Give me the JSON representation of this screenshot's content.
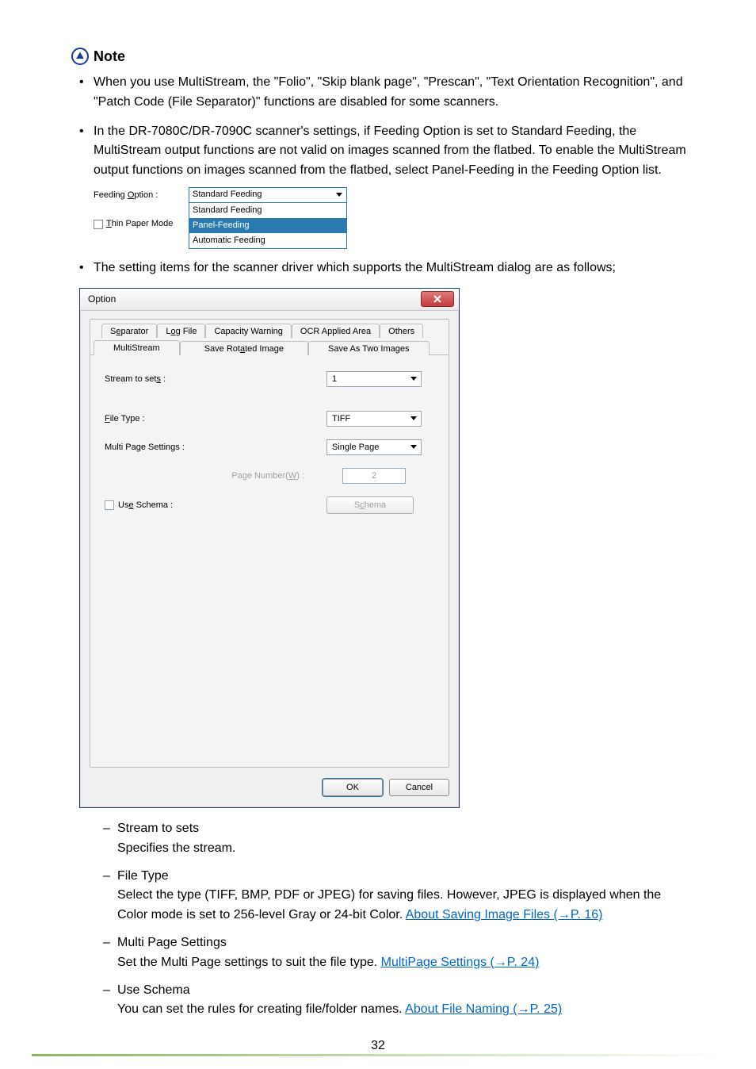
{
  "note": {
    "label": "Note"
  },
  "bullets": {
    "b1": "When you use MultiStream, the \"Folio\", \"Skip blank page\", \"Prescan\", \"Text Orientation Recognition\", and \"Patch Code (File Separator)\" functions are disabled for some scanners.",
    "b2": "In the DR-7080C/DR-7090C scanner's settings, if Feeding Option is set to Standard Feeding, the MultiStream output functions are not valid on images scanned from the flatbed. To enable the MultiStream output functions on images scanned from the flatbed, select Panel-Feeding in the Feeding Option list.",
    "b3": "The setting items for the scanner driver which supports the MultiStream dialog are as follows;"
  },
  "feed": {
    "label_option": "Feeding Option :",
    "label_thin": "Thin Paper Mode",
    "sel": "Standard Feeding",
    "opt1": "Standard Feeding",
    "opt2": "Panel-Feeding",
    "opt3": "Automatic Feeding"
  },
  "dialog": {
    "title": "Option",
    "tabs_row1": {
      "separator_pre": "S",
      "separator_u": "e",
      "separator_post": "parator",
      "logfile_pre": "L",
      "logfile_u": "o",
      "logfile_post": "g File",
      "capacity": "Capacity Warning",
      "ocr": "OCR Applied Area",
      "others": "Others"
    },
    "tabs_row2": {
      "multistream": "MultiStream",
      "save_rotated_pre": "Save Rot",
      "save_rotated_u": "a",
      "save_rotated_post": "ted Image",
      "save_two": "Save As Two Images"
    },
    "form": {
      "stream_pre": "Stream to set",
      "stream_u": "s",
      "stream_post": " :",
      "stream_val": "1",
      "filetype_u": "F",
      "filetype_post": "ile Type :",
      "filetype_val": "TIFF",
      "multipage_lbl": "Multi Page Settings :",
      "multipage_val": "Single Page",
      "pagenum_pre": "Page Number(",
      "pagenum_u": "W",
      "pagenum_post": ") :",
      "pagenum_val": "2",
      "useschema_pre": "Us",
      "useschema_u": "e",
      "useschema_post": " Schema :",
      "schema_btn_pre": "S",
      "schema_btn_u": "c",
      "schema_btn_post": "hema"
    },
    "buttons": {
      "ok": "OK",
      "cancel": "Cancel"
    }
  },
  "defs": {
    "d1_t": "Stream to sets",
    "d1_b": "Specifies the stream.",
    "d2_t": "File Type",
    "d2_b": "Select the type (TIFF, BMP, PDF or JPEG) for saving files. However, JPEG is displayed when the Color mode is set to 256-level Gray or 24-bit Color. ",
    "d2_link": "About Saving Image Files (→P. 16)",
    "d3_t": "Multi Page Settings",
    "d3_b": "Set the Multi Page settings to suit the file type. ",
    "d3_link": "MultiPage Settings (→P. 24)",
    "d4_t": "Use Schema",
    "d4_b": "You can set the rules for creating file/folder names. ",
    "d4_link": "About File Naming (→P. 25)"
  },
  "page_number": "32"
}
